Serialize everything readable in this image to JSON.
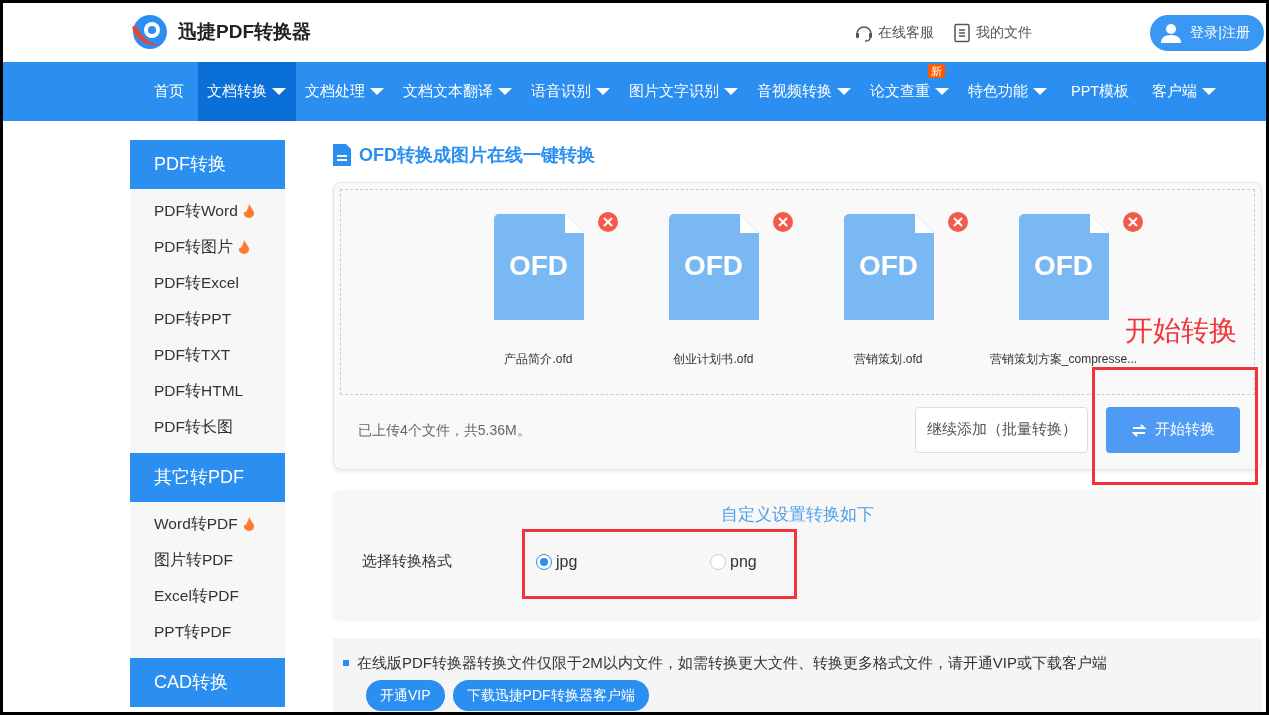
{
  "header": {
    "brand": "迅捷PDF转换器",
    "links": [
      {
        "kind": "headset",
        "label": "在线客服"
      },
      {
        "kind": "document",
        "label": "我的文件"
      }
    ],
    "login": {
      "label": "登录",
      "separator": "|",
      "label2": "注册"
    }
  },
  "nav": [
    {
      "label": "首页",
      "dropdown": false,
      "selected": false
    },
    {
      "label": "文档转换",
      "dropdown": true,
      "selected": true
    },
    {
      "label": "文档处理",
      "dropdown": true,
      "selected": false
    },
    {
      "label": "文档文本翻译",
      "dropdown": true,
      "selected": false
    },
    {
      "label": "语音识别",
      "dropdown": true,
      "selected": false
    },
    {
      "label": "图片文字识别",
      "dropdown": true,
      "selected": false
    },
    {
      "label": "音视频转换",
      "dropdown": true,
      "selected": false
    },
    {
      "label": "论文查重",
      "dropdown": true,
      "selected": false,
      "badge": "新"
    },
    {
      "label": "特色功能",
      "dropdown": true,
      "selected": false
    },
    {
      "label": "PPT模板",
      "dropdown": false,
      "selected": false
    },
    {
      "label": "客户端",
      "dropdown": true,
      "selected": false
    }
  ],
  "sidebar": [
    {
      "title": "PDF转换",
      "items": [
        {
          "label": "PDF转Word",
          "hot": true
        },
        {
          "label": "PDF转图片",
          "hot": true
        },
        {
          "label": "PDF转Excel",
          "hot": false
        },
        {
          "label": "PDF转PPT",
          "hot": false
        },
        {
          "label": "PDF转TXT",
          "hot": false
        },
        {
          "label": "PDF转HTML",
          "hot": false
        },
        {
          "label": "PDF转长图",
          "hot": false
        }
      ]
    },
    {
      "title": "其它转PDF",
      "items": [
        {
          "label": "Word转PDF",
          "hot": true
        },
        {
          "label": "图片转PDF",
          "hot": false
        },
        {
          "label": "Excel转PDF",
          "hot": false
        },
        {
          "label": "PPT转PDF",
          "hot": false
        }
      ]
    },
    {
      "title": "CAD转换"
    }
  ],
  "page_title": "OFD转换成图片在线一键转换",
  "files": [
    {
      "type": "OFD",
      "name": "产品简介.ofd"
    },
    {
      "type": "OFD",
      "name": "创业计划书.ofd"
    },
    {
      "type": "OFD",
      "name": "营销策划.ofd"
    },
    {
      "type": "OFD",
      "name": "营销策划方案_compresse..."
    }
  ],
  "upload_summary": "已上传4个文件，共5.36M。",
  "buttons": {
    "add_more": "继续添加（批量转换）",
    "start": "开始转换"
  },
  "settings": {
    "title": "自定义设置转换如下",
    "label": "选择转换格式",
    "formats": [
      {
        "label": "jpg",
        "selected": true
      },
      {
        "label": "png",
        "selected": false
      }
    ]
  },
  "notice": {
    "text": "在线版PDF转换器转换文件仅限于2M以内文件，如需转换更大文件、转换更多格式文件，请开通VIP或下载客户端",
    "buttons": [
      "开通VIP",
      "下载迅捷PDF转换器客户端"
    ]
  },
  "annotation": {
    "text": "开始转换"
  }
}
